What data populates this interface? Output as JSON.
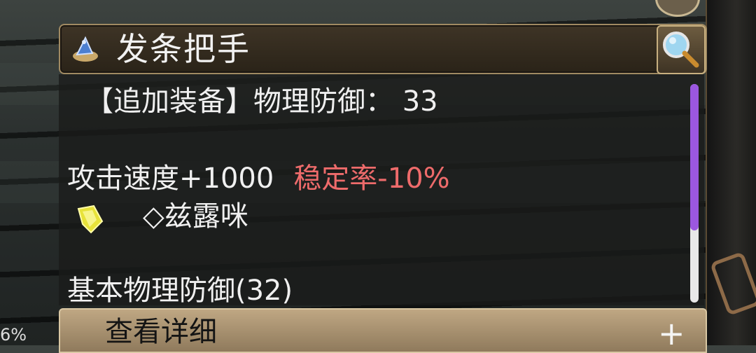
{
  "item": {
    "name": "发条把手",
    "line_1": "【追加装备】物理防御： 33",
    "line_2_main": "攻击速度+1000",
    "line_2_red": "稳定率-10%",
    "line_3": "◇兹露咪",
    "line_4": "基本物理防御(32)"
  },
  "footer": {
    "detail_label": "查看详细",
    "plus_symbol": "+"
  },
  "background": {
    "percent_text": "6%"
  },
  "icons": {
    "title_icon": "wizard-hat-icon",
    "search_icon": "magnifier-icon",
    "gem_icon": "yellow-crystal-icon"
  },
  "colors": {
    "red_text": "#ee6b6b",
    "scroll_thumb": "#9b57e0",
    "frame_gold": "#a08a62"
  },
  "scroll": {
    "visible_fraction": 0.67
  }
}
